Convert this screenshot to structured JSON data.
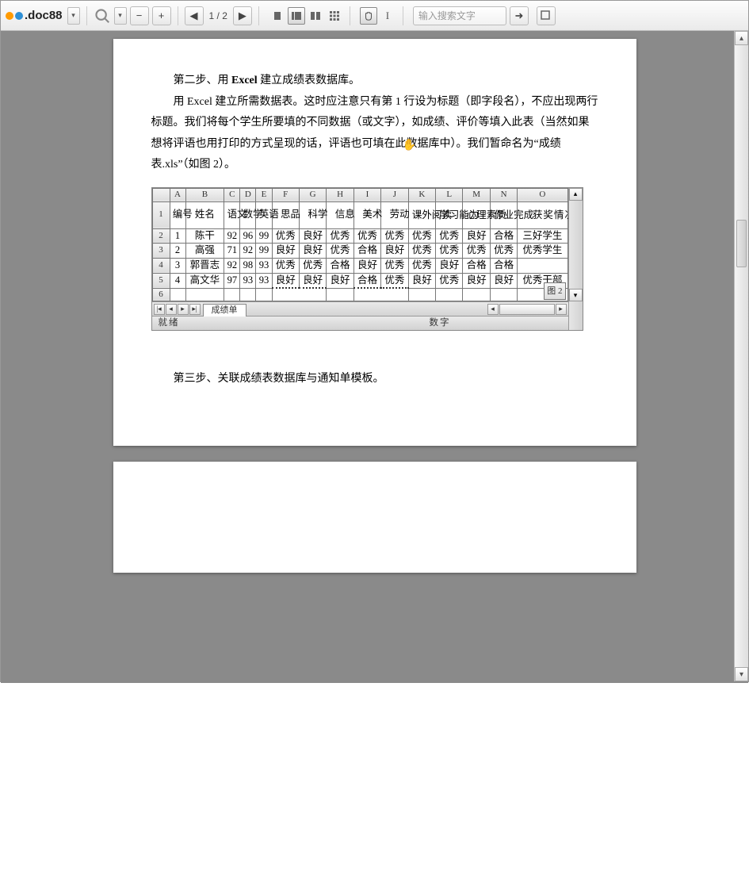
{
  "toolbar": {
    "brand": ".doc88",
    "page_indicator": "1 / 2",
    "search_placeholder": "输入搜索文字"
  },
  "document": {
    "para1_prefix": "第二步、用 ",
    "para1_bold": "Excel",
    "para1_suffix": " 建立成绩表数据库。",
    "para2": "用 Excel 建立所需数据表。这时应注意只有第 1 行设为标题（即字段名），不应出现两行标题。我们将每个学生所要填的不同数据（或文字），如成绩、评价等填入此表（当然如果想将评语也用打印的方式呈现的话，评语也可填在此数据库中）。我们暂命名为“成绩表.xls”（如图 2）。",
    "step3": "第三步、关联成绩表数据库与通知单模板。"
  },
  "excel": {
    "cols": [
      "A",
      "B",
      "C",
      "D",
      "E",
      "F",
      "G",
      "H",
      "I",
      "J",
      "K",
      "L",
      "M",
      "N",
      "O"
    ],
    "fields": [
      "编号",
      "姓名",
      "语文",
      "数学",
      "英语",
      "思品",
      "科学",
      "信息",
      "美术",
      "劳动",
      "课外阅读",
      "学习能力",
      "心理素质",
      "作业完成",
      "获奖情况"
    ],
    "rows": [
      [
        "1",
        "陈干",
        "92",
        "96",
        "99",
        "优秀",
        "良好",
        "优秀",
        "优秀",
        "优秀",
        "优秀",
        "优秀",
        "良好",
        "合格",
        "三好学生"
      ],
      [
        "2",
        "高强",
        "71",
        "92",
        "99",
        "良好",
        "良好",
        "优秀",
        "合格",
        "良好",
        "优秀",
        "优秀",
        "优秀",
        "优秀",
        "优秀学生"
      ],
      [
        "3",
        "郭晋志",
        "92",
        "98",
        "93",
        "优秀",
        "优秀",
        "合格",
        "良好",
        "优秀",
        "优秀",
        "良好",
        "合格",
        "合格",
        ""
      ],
      [
        "4",
        "高文华",
        "97",
        "93",
        "93",
        "良好",
        "良好",
        "良好",
        "合格",
        "优秀",
        "良好",
        "优秀",
        "良好",
        "良好",
        "优秀干部"
      ]
    ],
    "sheet_tab": "成绩单",
    "status_left": "就绪",
    "status_right": "数字",
    "figure_label": "图 2"
  }
}
